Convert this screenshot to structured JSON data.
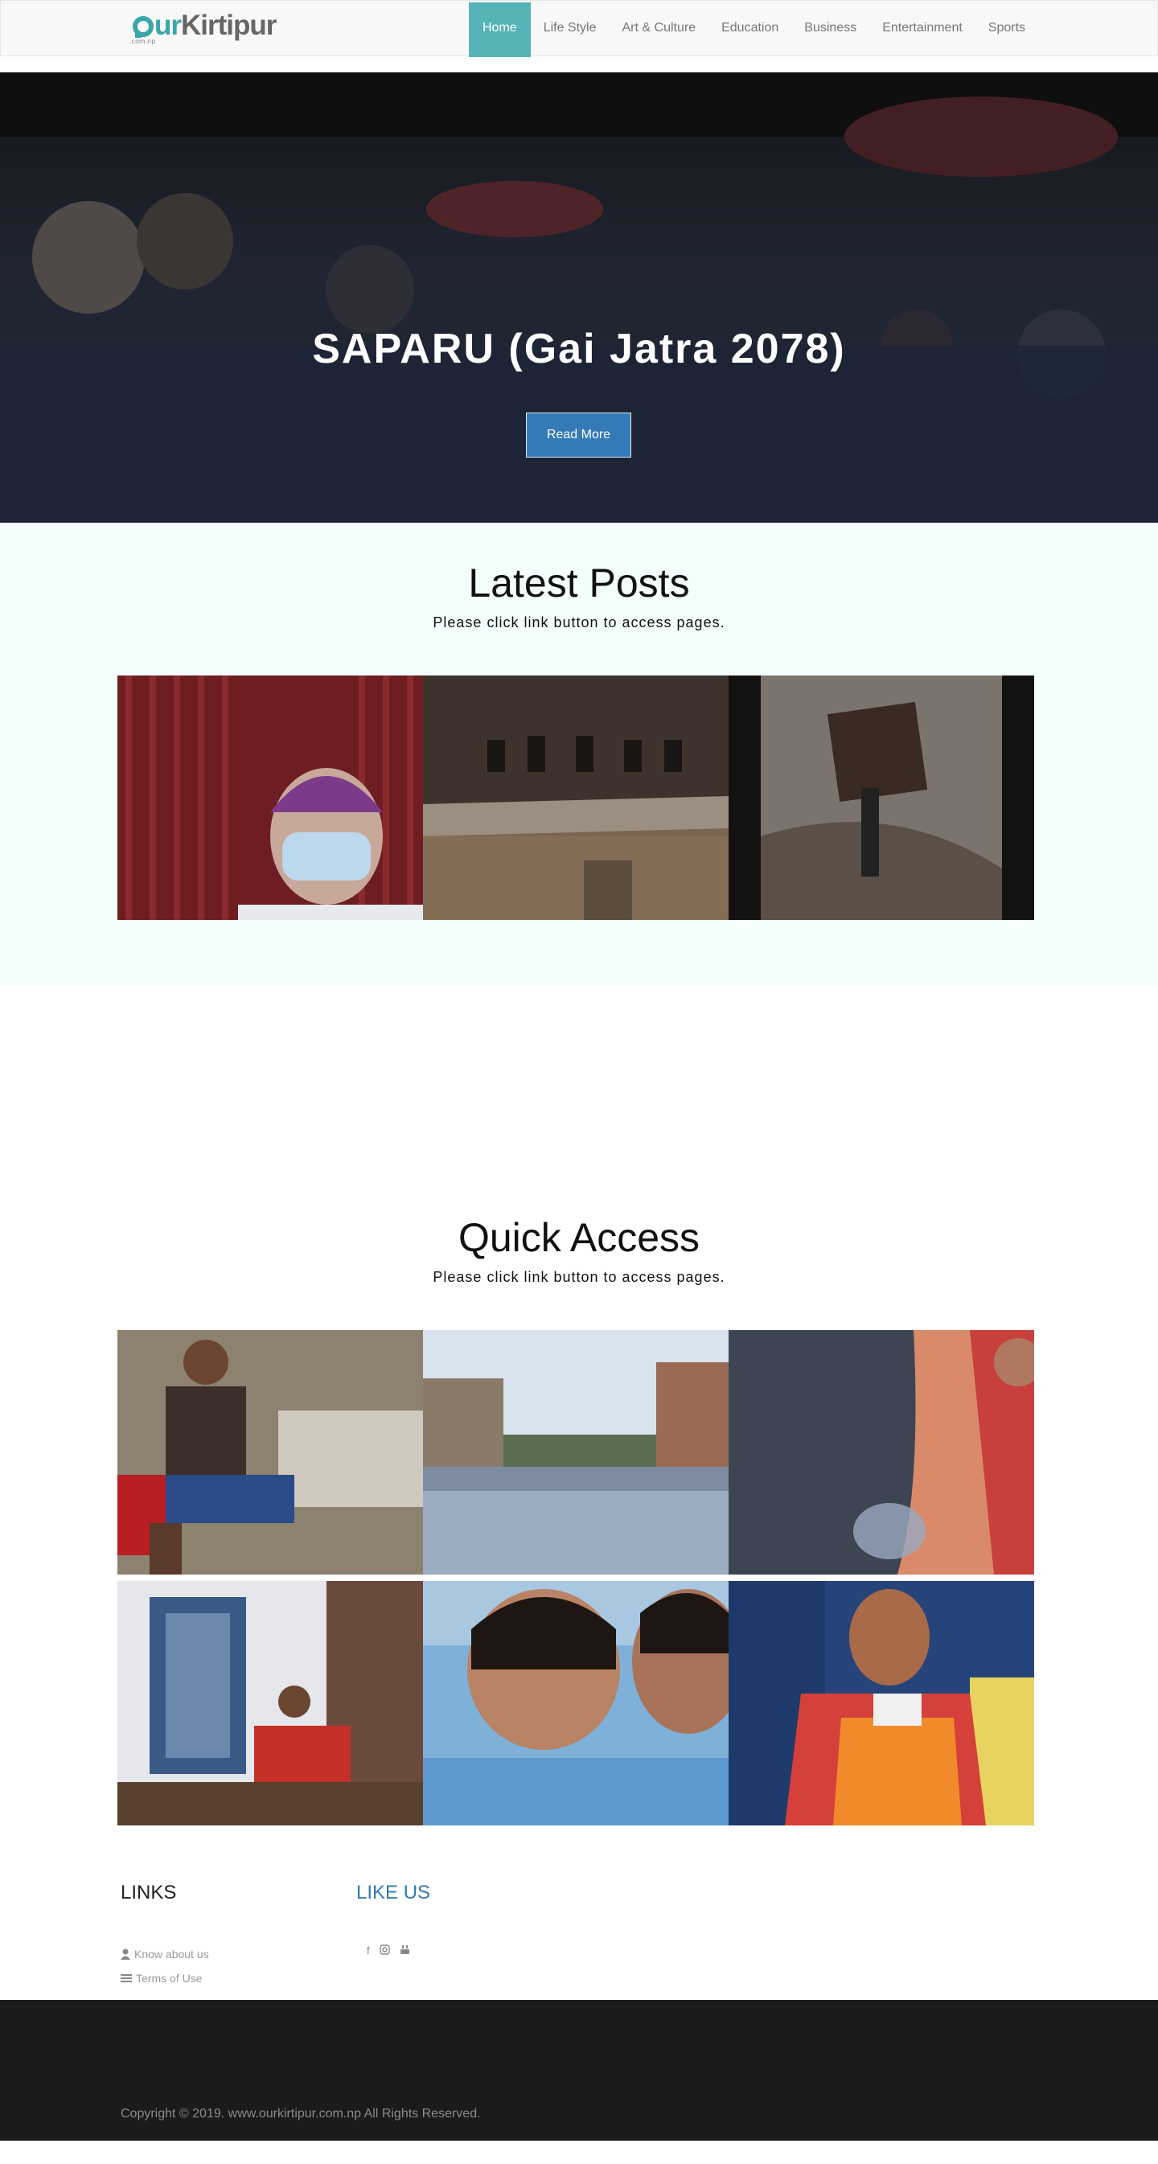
{
  "logo": {
    "text_ur": "urKirtipur",
    "sub": ".com.np"
  },
  "nav": {
    "items": [
      {
        "label": "Home",
        "active": true
      },
      {
        "label": "Life Style"
      },
      {
        "label": "Art & Culture"
      },
      {
        "label": "Education"
      },
      {
        "label": "Business"
      },
      {
        "label": "Entertainment"
      },
      {
        "label": "Sports"
      }
    ]
  },
  "hero": {
    "title": "SAPARU (Gai Jatra 2078)",
    "button_label": "Read More"
  },
  "latest": {
    "title": "Latest Posts",
    "subtitle": "Please click link button to access pages."
  },
  "quick": {
    "title": "Quick Access",
    "subtitle": "Please click link button to access pages."
  },
  "footer": {
    "links_heading": "LINKS",
    "like_heading": "LIKE US",
    "links": [
      {
        "label": "Know about us",
        "icon": "user-icon"
      },
      {
        "label": "Terms of Use",
        "icon": "list-icon"
      }
    ],
    "social": [
      "facebook-icon",
      "instagram-icon",
      "youtube-icon"
    ],
    "copyright": "Copyright © 2019. www.ourkirtipur.com.np All Rights Reserved."
  },
  "colors": {
    "accent": "#56b3b7",
    "button": "#337ab7",
    "latest_bg": "#f2fffc",
    "footer_bg": "#1b1b1b"
  }
}
